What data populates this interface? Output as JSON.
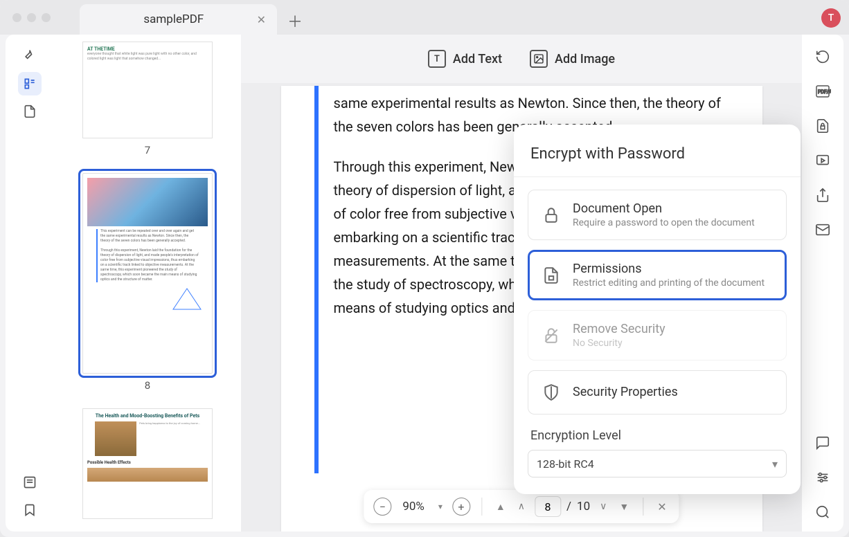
{
  "tab": {
    "title": "samplePDF",
    "avatar": "T"
  },
  "toolbar": {
    "add_text": "Add Text",
    "add_image": "Add Image"
  },
  "thumbs": {
    "p7": "7",
    "p8": "8"
  },
  "document": {
    "para1": "same experimental results as Newton. Since then, the theory of the seven colors has been generally accepted.",
    "para2": "Through this experiment, Newton laid the foundation for the theory of dispersion of light, and made people's interpretation of color free from subjective visual impressions, thus embarking on a scientific track linked to objective measurements. At the same time, this experiment pioneered the study of spectroscopy, which soon became the main means of studying optics and the structure of matter."
  },
  "zoom": {
    "value": "90%",
    "current_page": "8",
    "total_pages": "10",
    "separator": "/"
  },
  "panel": {
    "title": "Encrypt with Password",
    "doc_open": {
      "title": "Document Open",
      "sub": "Require a password to open the document"
    },
    "permissions": {
      "title": "Permissions",
      "sub": "Restrict editing and printing of the document"
    },
    "remove": {
      "title": "Remove Security",
      "sub": "No Security"
    },
    "props": {
      "title": "Security Properties"
    },
    "enc_label": "Encryption Level",
    "enc_value": "128-bit RC4"
  },
  "thumb9": {
    "title": "The Health and Mood-Boosting Benefits of Pets",
    "subhead": "Possible Health Effects"
  },
  "thumb7_head": "AT THETIME"
}
